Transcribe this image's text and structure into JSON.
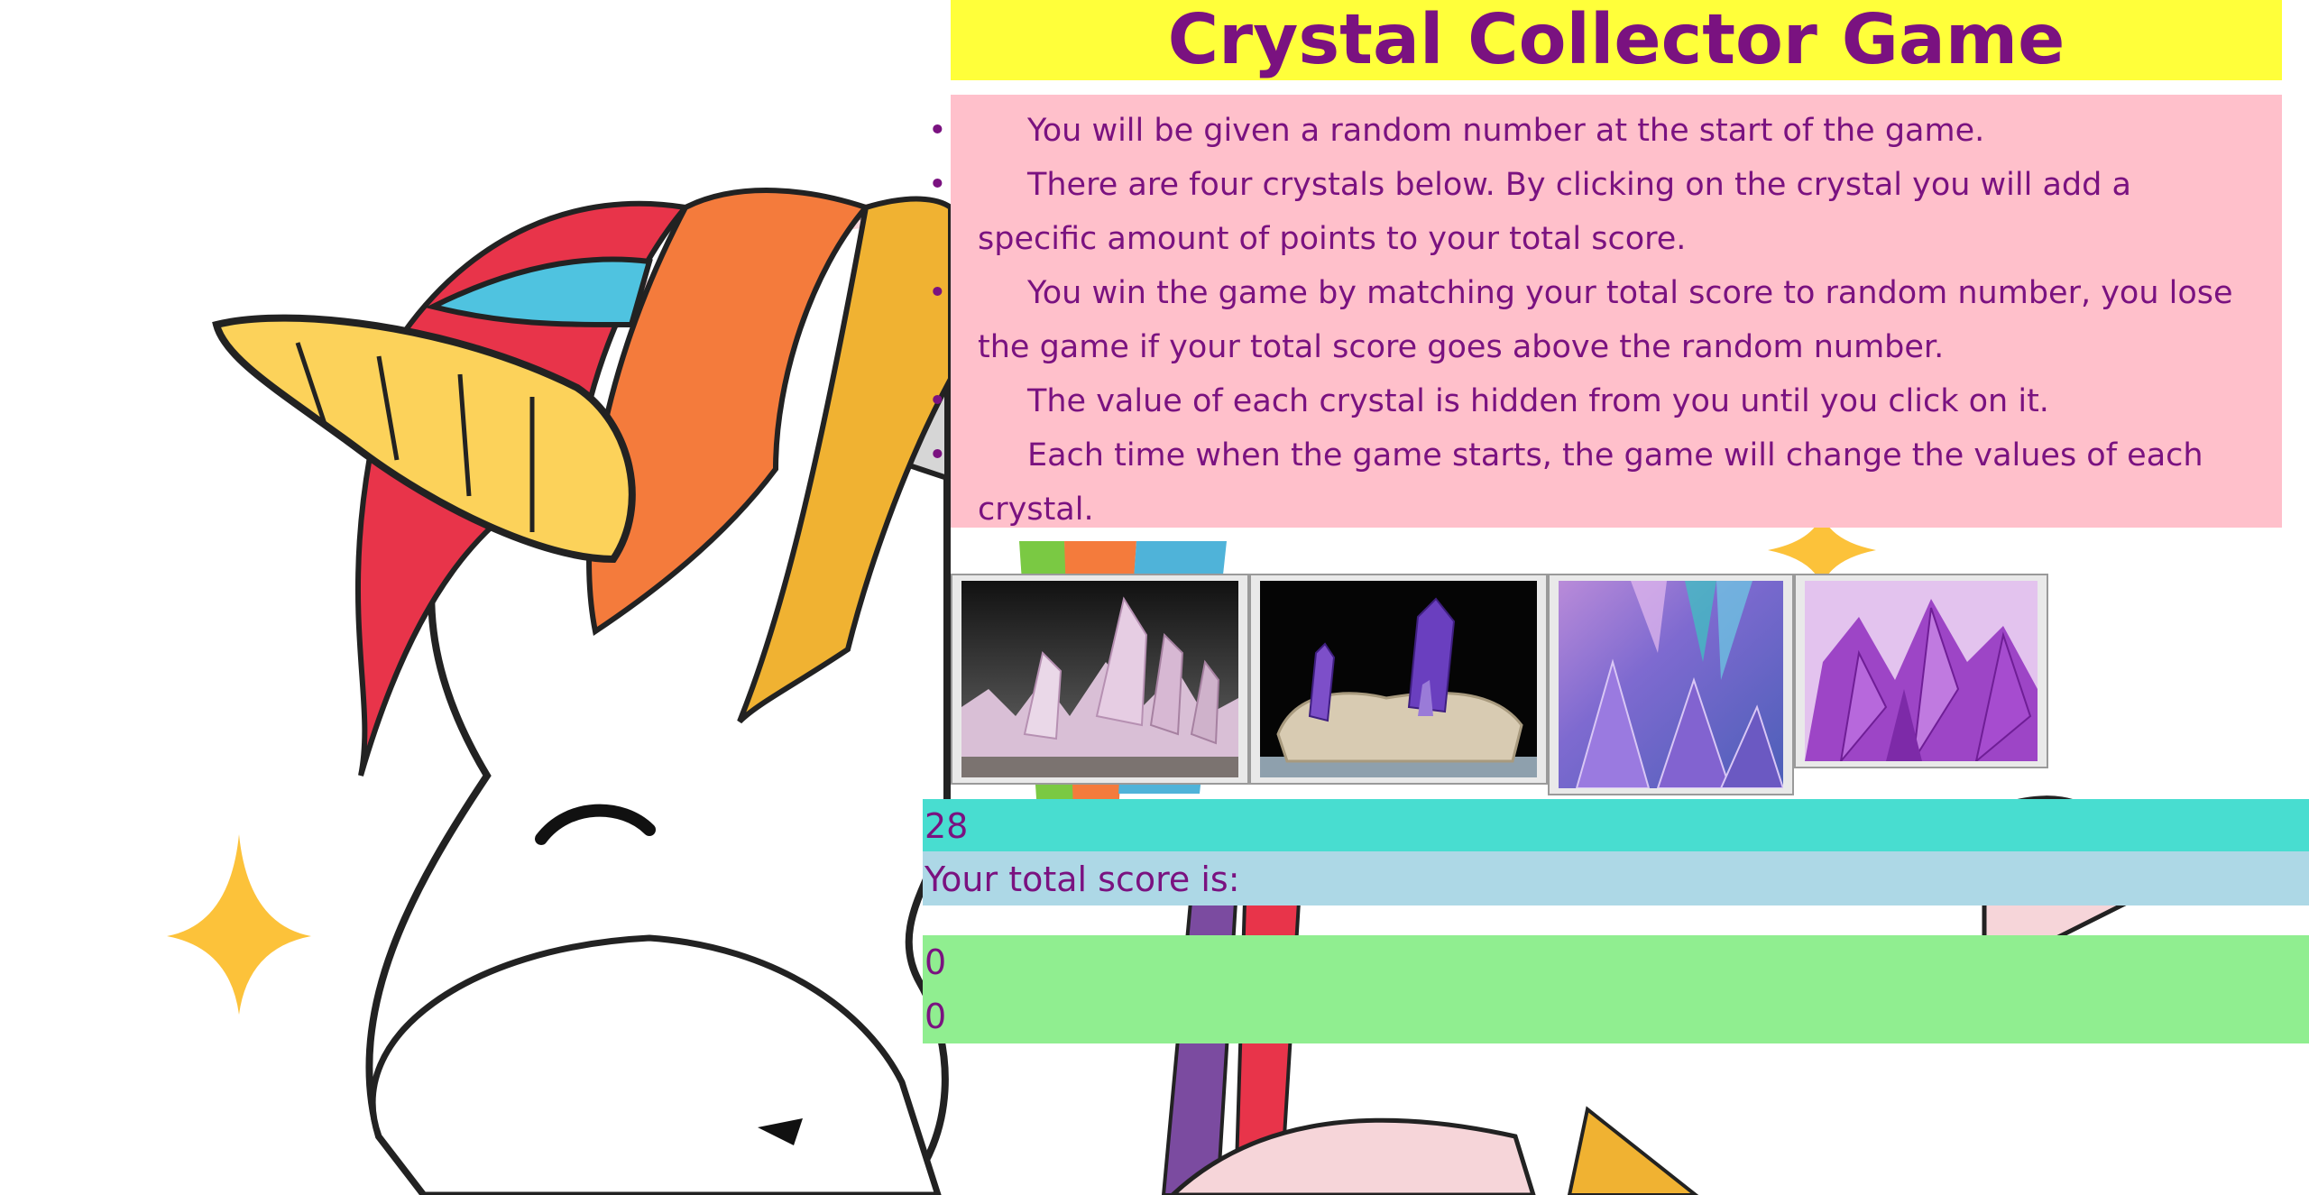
{
  "title": "Crystal Collector Game",
  "rules": [
    "You will be given a random number at the start of the game.",
    "There are four crystals below. By clicking on the crystal you will add a specific amount of points to your total score.",
    "You win the game by matching your total score to random number, you lose the game if your total score goes above the random number.",
    "The value of each crystal is hidden from you until you click on it.",
    "Each time when the game starts, the game will change the values of each crystal."
  ],
  "crystals": [
    {
      "name": "crystal-1",
      "icon": "pale-quartz-cluster"
    },
    {
      "name": "crystal-2",
      "icon": "amethyst-on-rock"
    },
    {
      "name": "crystal-3",
      "icon": "iridescent-crystal"
    },
    {
      "name": "crystal-4",
      "icon": "purple-amethyst"
    }
  ],
  "random_number": "28",
  "score_label": "Your total score is:",
  "counters": [
    "0",
    "0"
  ],
  "colors": {
    "title_bg": "#ffff3a",
    "text": "#7a1280",
    "rules_bg": "#ffc0cb",
    "random_bg": "#48ddd0",
    "label_bg": "#add8e6",
    "score_bg": "#90ee90"
  }
}
